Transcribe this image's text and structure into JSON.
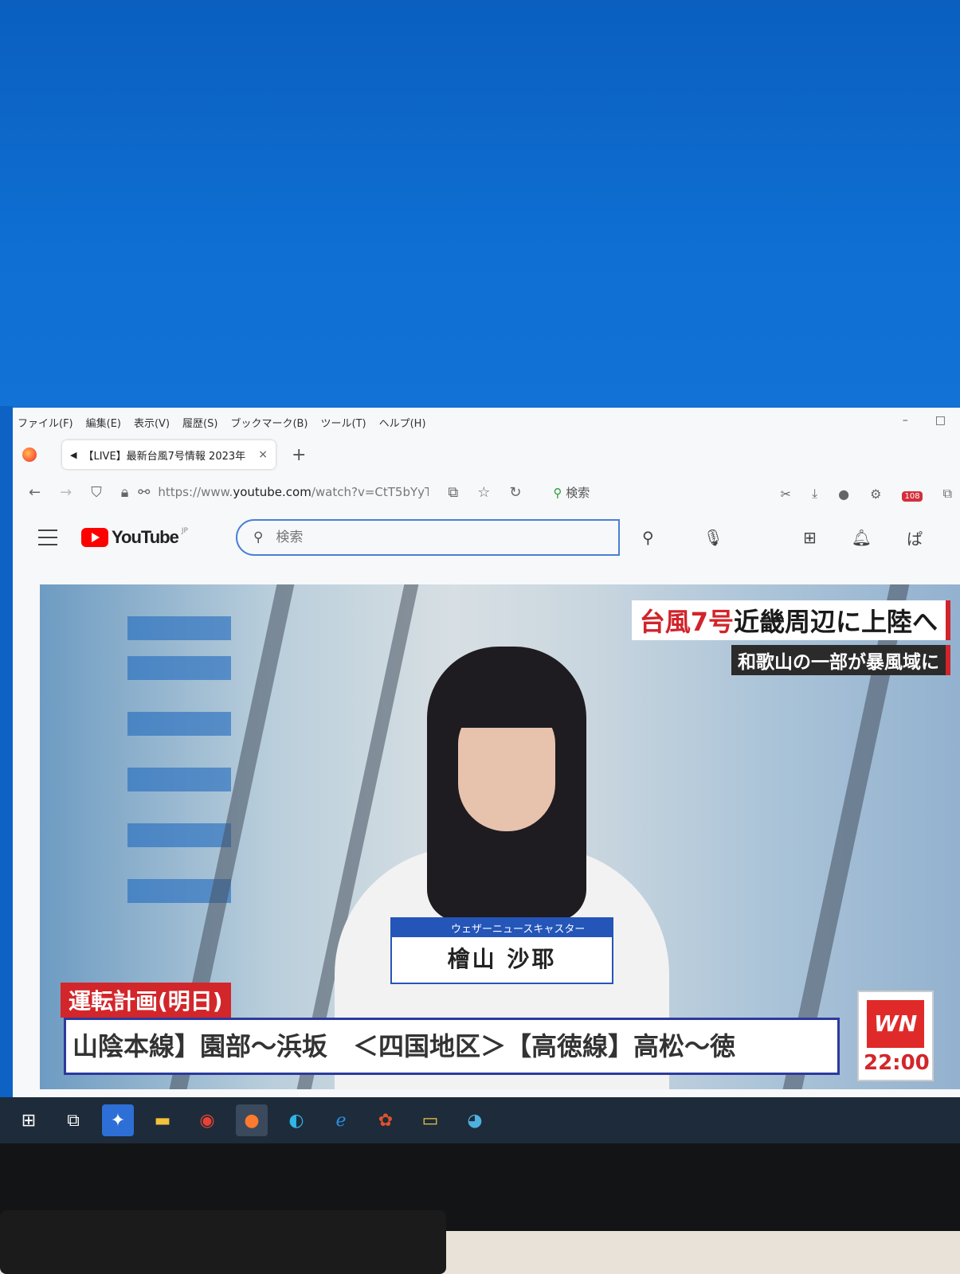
{
  "menubar": {
    "items": [
      "ファイル(F)",
      "編集(E)",
      "表示(V)",
      "履歴(S)",
      "ブックマーク(B)",
      "ツール(T)",
      "ヘルプ(H)"
    ]
  },
  "window_controls": {
    "minimize": "–",
    "maximize": "□"
  },
  "tab": {
    "title": "【LIVE】最新台風7号情報 2023年",
    "close": "×",
    "new": "+"
  },
  "navbar": {
    "url_prefix": "https://www.",
    "url_domain": "youtube.com",
    "url_rest": "/watch?v=CtT5bYyT",
    "search_label": "検索",
    "extension_badge": "108"
  },
  "youtube": {
    "logo_text": "YouTube",
    "region": "JP",
    "search_placeholder": "検索",
    "avatar": "ぱ"
  },
  "video": {
    "headline_red": "台風7号",
    "headline_rest": "近畿周辺に上陸へ",
    "subheadline": "和歌山の一部が暴風域に",
    "caster_role": "ウェザーニュースキャスター",
    "caster_name": "檜山 沙耶",
    "schedule_tag": "運転計画(明日)",
    "ticker": "山陰本線】園部～浜坂　＜四国地区＞【高徳線】高松～徳",
    "logo_text": "WN",
    "time": "22:00"
  },
  "icons": [
    "back-icon",
    "forward-icon",
    "shield-icon",
    "lock-icon",
    "permissions-icon",
    "reader-icon",
    "star-icon",
    "reload-icon",
    "search-icon",
    "screenshot-icon",
    "download-icon",
    "account-icon",
    "settings-icon",
    "adblock-icon",
    "extensions-icon",
    "mic-icon",
    "create-icon",
    "bell-icon"
  ]
}
